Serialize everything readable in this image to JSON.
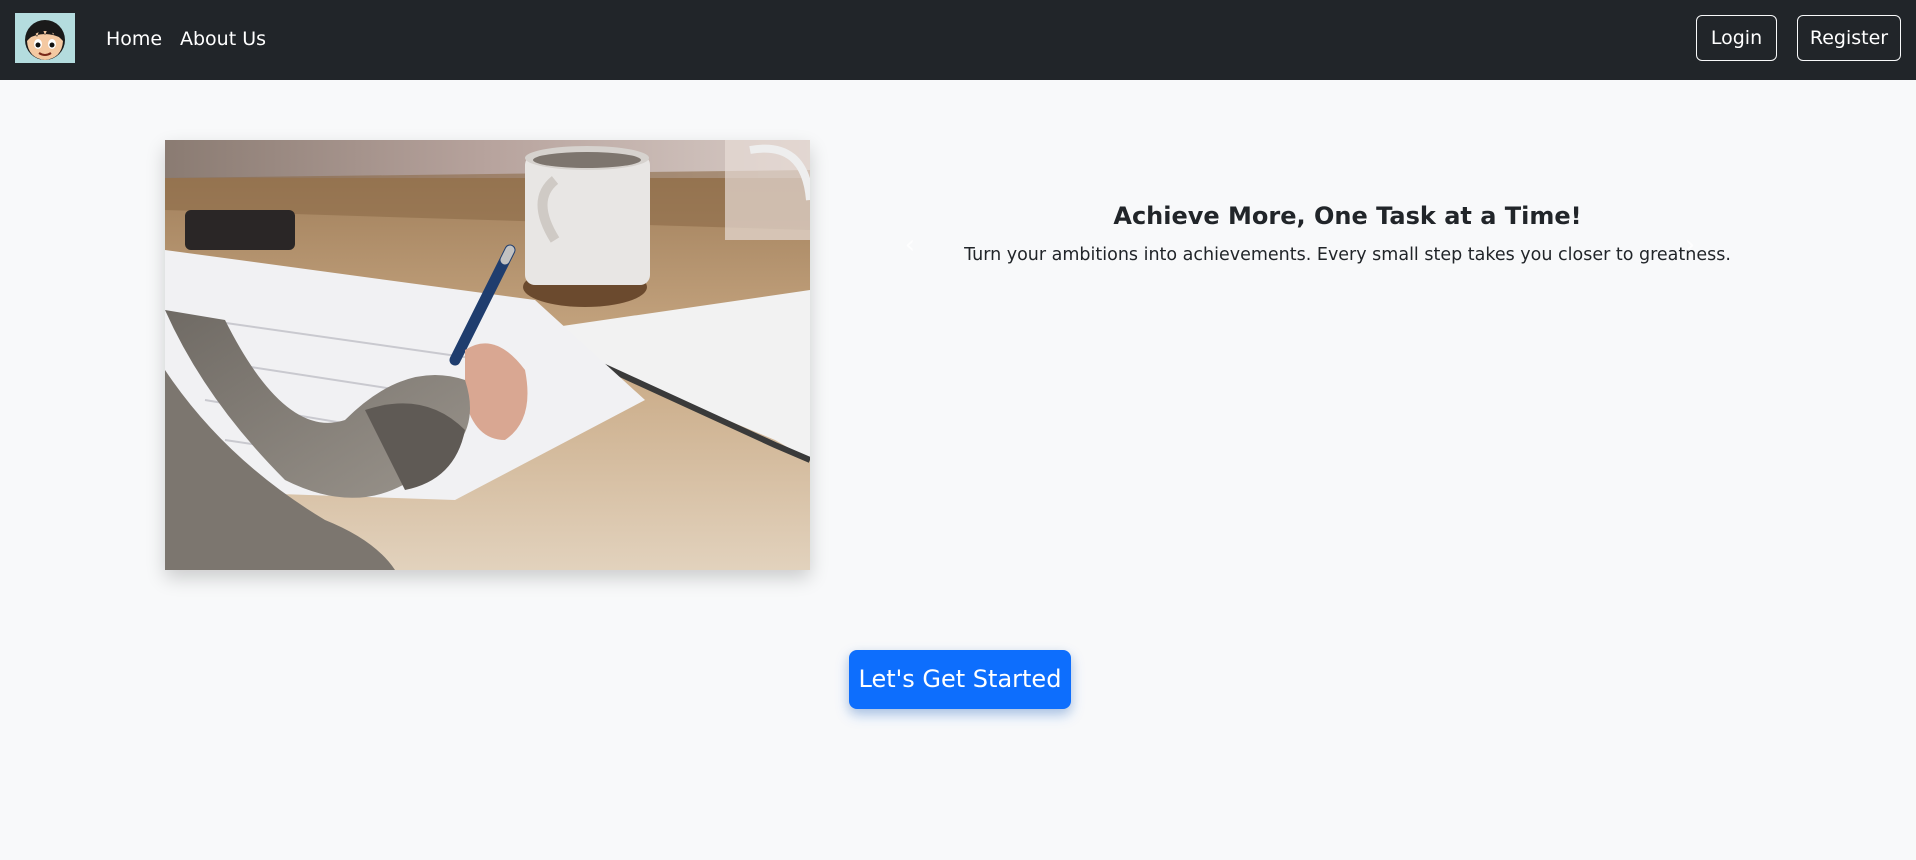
{
  "navbar": {
    "logo_icon": "anime-character-avatar-icon",
    "links": [
      {
        "label": "Home"
      },
      {
        "label": "About Us"
      }
    ],
    "login_label": "Login",
    "register_label": "Register"
  },
  "hero": {
    "image_icon": "person-writing-at-desk-photo",
    "carousel": {
      "title": "Achieve More, One Task at a Time!",
      "text": "Turn your ambitions into achievements. Every small step takes you closer to greatness.",
      "prev_icon": "chevron-left-icon",
      "next_icon": "chevron-right-icon"
    },
    "cta_label": "Let's Get Started"
  },
  "colors": {
    "navbar_bg": "#212529",
    "page_bg": "#f8f9fa",
    "primary": "#0d6efd"
  }
}
